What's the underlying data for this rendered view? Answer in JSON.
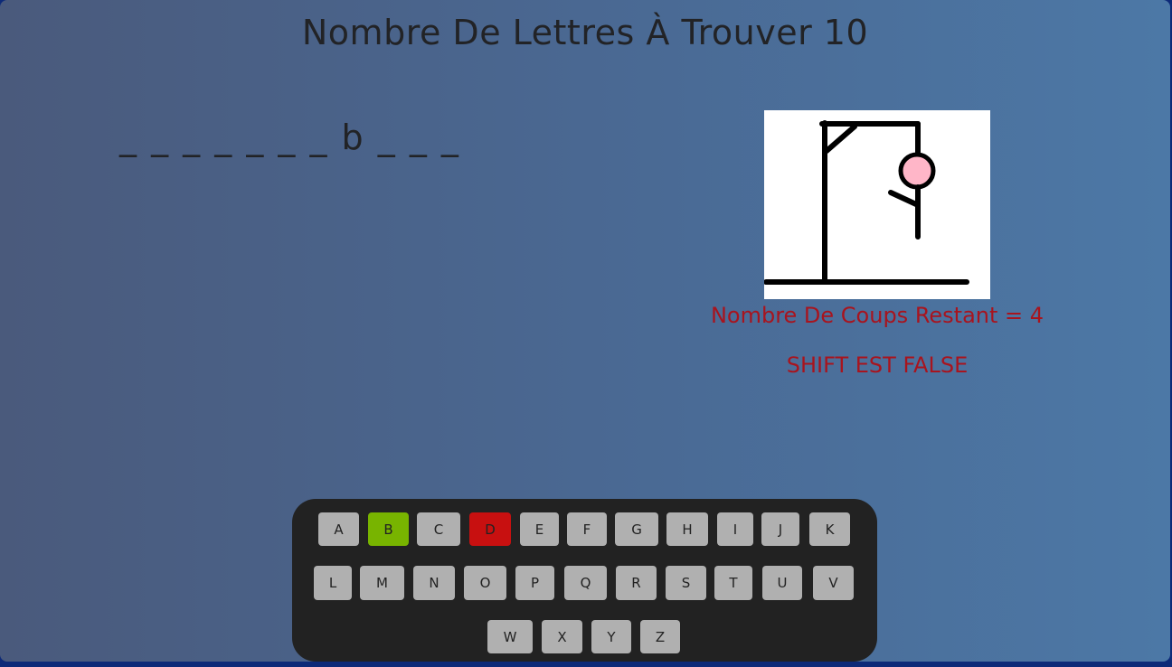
{
  "title": "Nombre De Lettres À Trouver 10",
  "word_display": "_ _ _ _ _ _ _ b _ _ _",
  "status": {
    "remaining": "Nombre De Coups Restant = 4",
    "shift": "SHIFT EST FALSE"
  },
  "keyboard": {
    "keys": [
      {
        "label": "A",
        "state": "unused"
      },
      {
        "label": "B",
        "state": "correct"
      },
      {
        "label": "C",
        "state": "unused"
      },
      {
        "label": "D",
        "state": "wrong"
      },
      {
        "label": "E",
        "state": "unused"
      },
      {
        "label": "F",
        "state": "unused"
      },
      {
        "label": "G",
        "state": "unused"
      },
      {
        "label": "H",
        "state": "unused"
      },
      {
        "label": "I",
        "state": "unused"
      },
      {
        "label": "J",
        "state": "unused"
      },
      {
        "label": "K",
        "state": "unused"
      },
      {
        "label": "L",
        "state": "unused"
      },
      {
        "label": "M",
        "state": "unused"
      },
      {
        "label": "N",
        "state": "unused"
      },
      {
        "label": "O",
        "state": "unused"
      },
      {
        "label": "P",
        "state": "unused"
      },
      {
        "label": "Q",
        "state": "unused"
      },
      {
        "label": "R",
        "state": "unused"
      },
      {
        "label": "S",
        "state": "unused"
      },
      {
        "label": "T",
        "state": "unused"
      },
      {
        "label": "U",
        "state": "unused"
      },
      {
        "label": "V",
        "state": "unused"
      },
      {
        "label": "W",
        "state": "unused"
      },
      {
        "label": "X",
        "state": "unused"
      },
      {
        "label": "Y",
        "state": "unused"
      },
      {
        "label": "Z",
        "state": "unused"
      }
    ]
  },
  "colors": {
    "correct": "#78b400",
    "wrong": "#c81010",
    "key_default": "#b0b0b0",
    "status_text": "#a8141e",
    "head_fill": "#ffb6c8"
  }
}
